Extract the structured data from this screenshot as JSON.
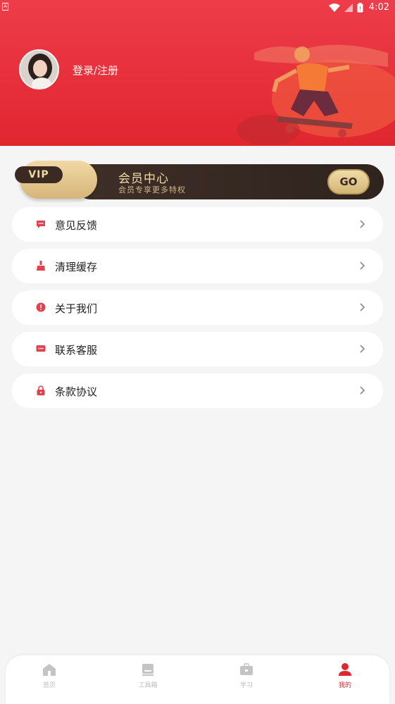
{
  "status_bar": {
    "left_badge": "A",
    "time": "4:02"
  },
  "header": {
    "login_text": "登录/注册"
  },
  "vip": {
    "badge": "VIP",
    "title": "会员中心",
    "subtitle": "会员专享更多特权",
    "go_label": "GO"
  },
  "menu": {
    "items": [
      {
        "label": "意见反馈",
        "icon": "feedback-icon"
      },
      {
        "label": "清理缓存",
        "icon": "broom-icon"
      },
      {
        "label": "关于我们",
        "icon": "info-icon"
      },
      {
        "label": "联系客服",
        "icon": "chat-icon"
      },
      {
        "label": "条款协议",
        "icon": "lock-icon"
      }
    ]
  },
  "tabs": [
    {
      "label": "首页",
      "icon": "home-icon",
      "active": false
    },
    {
      "label": "工具箱",
      "icon": "toolbox-icon",
      "active": false
    },
    {
      "label": "学习",
      "icon": "briefcase-icon",
      "active": false
    },
    {
      "label": "我的",
      "icon": "user-icon",
      "active": true
    }
  ],
  "colors": {
    "accent": "#e0262f",
    "vip_gold": "#f0d7a1",
    "vip_dark": "#3a2a22",
    "page_bg": "#f5f5f5"
  }
}
